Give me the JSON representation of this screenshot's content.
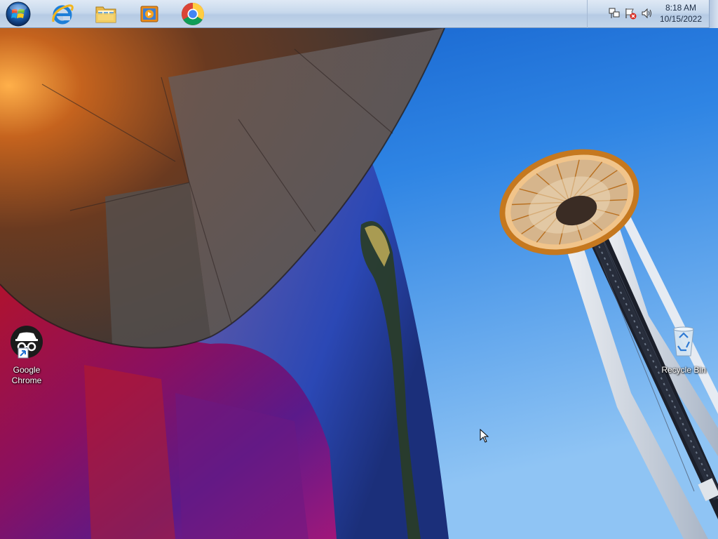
{
  "taskbar": {
    "start_button": "start-orb",
    "pinned": [
      {
        "name": "internet-explorer",
        "icon": "internet-explorer-icon"
      },
      {
        "name": "windows-explorer",
        "icon": "folder-icon"
      },
      {
        "name": "media-player",
        "icon": "media-player-icon"
      },
      {
        "name": "google-chrome",
        "icon": "chrome-icon"
      }
    ],
    "tray": {
      "icons": [
        "network-icon",
        "action-center-icon",
        "volume-icon"
      ],
      "time": "8:18 AM",
      "date": "10/15/2022"
    }
  },
  "desktop": {
    "icons": [
      {
        "label": "Google Chrome",
        "icon": "chrome-incognito-icon"
      },
      {
        "label": "Recycle Bin",
        "icon": "recycle-bin-icon"
      }
    ]
  },
  "colors": {
    "sky": "#2a7de0",
    "taskbar": "#c7d8ec",
    "tower_gold": "#d08a2c"
  }
}
